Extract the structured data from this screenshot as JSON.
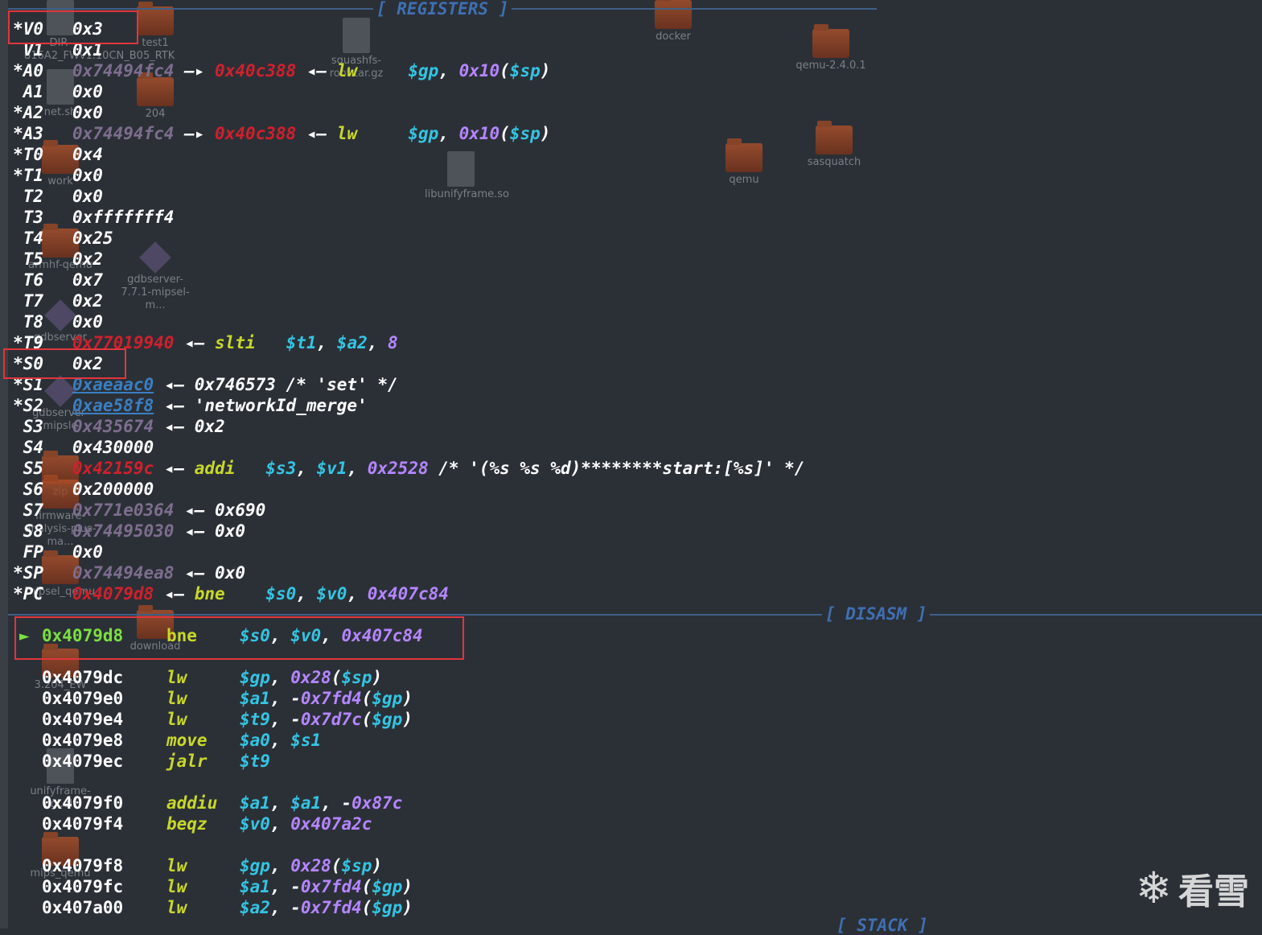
{
  "colors": {
    "background": "#2b3037",
    "header": "#3f6fb0",
    "pointer": "#d0202b",
    "data": "#7d6d8e",
    "mnemonic": "#c8d82a",
    "register": "#34c5e3",
    "immediate": "#b586ff",
    "highlight": "#e0363c"
  },
  "desktop": {
    "icons": [
      {
        "label": "DIR-816A2_FWv1.10CN_B05_RTK",
        "icon": "file-icon"
      },
      {
        "label": "test1",
        "icon": "folder-icon"
      },
      {
        "label": "squashfs-root.tar.gz",
        "icon": "archive-icon"
      },
      {
        "label": "docker",
        "icon": "folder-icon"
      },
      {
        "label": "qemu-2.4.0.1",
        "icon": "folder-icon"
      },
      {
        "label": "net.sh",
        "icon": "file-icon"
      },
      {
        "label": "204",
        "icon": "folder-icon"
      },
      {
        "label": "sasquatch",
        "icon": "folder-icon"
      },
      {
        "label": "qemu",
        "icon": "folder-icon"
      },
      {
        "label": "work",
        "icon": "folder-icon"
      },
      {
        "label": "libunifyframe.so",
        "icon": "file-icon"
      },
      {
        "label": "armhf-qemu",
        "icon": "folder-icon"
      },
      {
        "label": "gdbserver-7.7.1-mipsel-m...",
        "icon": "binary-icon"
      },
      {
        "label": "gdbserver",
        "icon": "binary-icon"
      },
      {
        "label": "gdbserver-mipsle",
        "icon": "binary-icon"
      },
      {
        "label": "zip",
        "icon": "folder-icon"
      },
      {
        "label": "firmware-analysis-plus-ma...",
        "icon": "folder-icon"
      },
      {
        "label": "mipsel_qemu",
        "icon": "folder-icon"
      },
      {
        "label": "download",
        "icon": "folder-icon"
      },
      {
        "label": "3.204_EW",
        "icon": "folder-icon"
      },
      {
        "label": "unifyframe-cgi.elf",
        "icon": "file-icon"
      },
      {
        "label": "mips_qemu",
        "icon": "folder-icon"
      }
    ]
  },
  "sections": {
    "registers": "[ REGISTERS ]",
    "disasm": "[ DISASM ]",
    "stack": "[ STACK ]"
  },
  "registers": [
    {
      "name": "*V0",
      "value": "0x3"
    },
    {
      "name": "V1",
      "value": "0x1"
    },
    {
      "name": "*A0",
      "addr": "0x74494fc4",
      "arrow": "—▸",
      "ptr": "0x40c388",
      "arrow2": "◂—",
      "mn": "lw",
      "ops": [
        [
          "$gp",
          "cyan"
        ],
        [
          ", ",
          "w"
        ],
        [
          "0x10",
          "purp"
        ],
        [
          "(",
          "w"
        ],
        [
          "$sp",
          "cyan"
        ],
        [
          ")",
          "w"
        ]
      ]
    },
    {
      "name": "A1",
      "value": "0x0"
    },
    {
      "name": "*A2",
      "value": "0x0"
    },
    {
      "name": "*A3",
      "addr": "0x74494fc4",
      "arrow": "—▸",
      "ptr": "0x40c388",
      "arrow2": "◂—",
      "mn": "lw",
      "ops": [
        [
          "$gp",
          "cyan"
        ],
        [
          ", ",
          "w"
        ],
        [
          "0x10",
          "purp"
        ],
        [
          "(",
          "w"
        ],
        [
          "$sp",
          "cyan"
        ],
        [
          ")",
          "w"
        ]
      ]
    },
    {
      "name": "*T0",
      "value": "0x4"
    },
    {
      "name": "*T1",
      "value": "0x0"
    },
    {
      "name": "T2",
      "value": "0x0"
    },
    {
      "name": "T3",
      "value": "0xfffffff4"
    },
    {
      "name": "T4",
      "value": "0x25"
    },
    {
      "name": "T5",
      "value": "0x2"
    },
    {
      "name": "T6",
      "value": "0x7"
    },
    {
      "name": "T7",
      "value": "0x2"
    },
    {
      "name": "T8",
      "value": "0x0"
    },
    {
      "name": "*T9",
      "red": "0x77019940",
      "arrow2": "◂—",
      "mn": "slti",
      "ops": [
        [
          "$t1",
          "cyan"
        ],
        [
          ", ",
          "w"
        ],
        [
          "$a2",
          "cyan"
        ],
        [
          ", ",
          "w"
        ],
        [
          "8",
          "purp"
        ]
      ]
    },
    {
      "name": "*S0",
      "value": "0x2"
    },
    {
      "name": "*S1",
      "link": "0xaeaac0",
      "arrow2": "◂—",
      "tail": "0x746573 /* 'set' */"
    },
    {
      "name": "*S2",
      "link": "0xae58f8",
      "arrow2": "◂—",
      "tail": "'networkId_merge'"
    },
    {
      "name": "S3",
      "dim": "0x435674",
      "arrow2": "◂—",
      "tail": "0x2"
    },
    {
      "name": "S4",
      "value": "0x430000"
    },
    {
      "name": "S5",
      "red": "0x42159c",
      "arrow2": "◂—",
      "mn": "addi",
      "ops": [
        [
          "$s3",
          "cyan"
        ],
        [
          ", ",
          "w"
        ],
        [
          "$v1",
          "cyan"
        ],
        [
          ", ",
          "w"
        ],
        [
          "0x2528",
          "purp"
        ],
        [
          " /* '(%s %s %d)********start:[%s]' */",
          "w"
        ]
      ]
    },
    {
      "name": "S6",
      "value": "0x200000"
    },
    {
      "name": "S7",
      "dim": "0x771e0364",
      "arrow2": "◂—",
      "tail": "0x690"
    },
    {
      "name": "S8",
      "dim": "0x74495030",
      "arrow2": "◂—",
      "tail": "0x0"
    },
    {
      "name": "FP",
      "value": "0x0"
    },
    {
      "name": "*SP",
      "dim": "0x74494ea8",
      "arrow2": "◂—",
      "tail": "0x0"
    },
    {
      "name": "*PC",
      "red": "0x4079d8",
      "arrow2": "◂—",
      "mn": "bne",
      "ops": [
        [
          "$s0",
          "cyan"
        ],
        [
          ", ",
          "w"
        ],
        [
          "$v0",
          "cyan"
        ],
        [
          ", ",
          "w"
        ],
        [
          "0x407c84",
          "purp"
        ]
      ]
    }
  ],
  "disasm": [
    {
      "arrow": "►",
      "addr": "0x4079d8",
      "mn": "bne",
      "ops": [
        [
          "$s0",
          "cyan"
        ],
        [
          ", ",
          "w"
        ],
        [
          "$v0",
          "cyan"
        ],
        [
          ", ",
          "w"
        ],
        [
          "0x407c84",
          "purp"
        ]
      ],
      "current": true
    },
    {
      "gap": true
    },
    {
      "addr": "0x4079dc",
      "mn": "lw",
      "ops": [
        [
          "$gp",
          "cyan"
        ],
        [
          ", ",
          "w"
        ],
        [
          "0x28",
          "purp"
        ],
        [
          "(",
          "w"
        ],
        [
          "$sp",
          "cyan"
        ],
        [
          ")",
          "w"
        ]
      ]
    },
    {
      "addr": "0x4079e0",
      "mn": "lw",
      "ops": [
        [
          "$a1",
          "cyan"
        ],
        [
          ", -",
          "w"
        ],
        [
          "0x7fd4",
          "purp"
        ],
        [
          "(",
          "w"
        ],
        [
          "$gp",
          "cyan"
        ],
        [
          ")",
          "w"
        ]
      ]
    },
    {
      "addr": "0x4079e4",
      "mn": "lw",
      "ops": [
        [
          "$t9",
          "cyan"
        ],
        [
          ", -",
          "w"
        ],
        [
          "0x7d7c",
          "purp"
        ],
        [
          "(",
          "w"
        ],
        [
          "$gp",
          "cyan"
        ],
        [
          ")",
          "w"
        ]
      ]
    },
    {
      "addr": "0x4079e8",
      "mn": "move",
      "ops": [
        [
          "$a0",
          "cyan"
        ],
        [
          ", ",
          "w"
        ],
        [
          "$s1",
          "cyan"
        ]
      ]
    },
    {
      "addr": "0x4079ec",
      "mn": "jalr",
      "ops": [
        [
          "$t9",
          "cyan"
        ]
      ]
    },
    {
      "gap": true
    },
    {
      "addr": "0x4079f0",
      "mn": "addiu",
      "ops": [
        [
          "$a1",
          "cyan"
        ],
        [
          ", ",
          "w"
        ],
        [
          "$a1",
          "cyan"
        ],
        [
          ", -",
          "w"
        ],
        [
          "0x87c",
          "purp"
        ]
      ]
    },
    {
      "addr": "0x4079f4",
      "mn": "beqz",
      "ops": [
        [
          "$v0",
          "cyan"
        ],
        [
          ", ",
          "w"
        ],
        [
          "0x407a2c",
          "purp"
        ]
      ]
    },
    {
      "gap": true
    },
    {
      "addr": "0x4079f8",
      "mn": "lw",
      "ops": [
        [
          "$gp",
          "cyan"
        ],
        [
          ", ",
          "w"
        ],
        [
          "0x28",
          "purp"
        ],
        [
          "(",
          "w"
        ],
        [
          "$sp",
          "cyan"
        ],
        [
          ")",
          "w"
        ]
      ]
    },
    {
      "addr": "0x4079fc",
      "mn": "lw",
      "ops": [
        [
          "$a1",
          "cyan"
        ],
        [
          ", -",
          "w"
        ],
        [
          "0x7fd4",
          "purp"
        ],
        [
          "(",
          "w"
        ],
        [
          "$gp",
          "cyan"
        ],
        [
          ")",
          "w"
        ]
      ]
    },
    {
      "addr": "0x407a00",
      "mn": "lw",
      "ops": [
        [
          "$a2",
          "cyan"
        ],
        [
          ", -",
          "w"
        ],
        [
          "0x7fd4",
          "purp"
        ],
        [
          "(",
          "w"
        ],
        [
          "$gp",
          "cyan"
        ],
        [
          ")",
          "w"
        ]
      ]
    }
  ],
  "watermark": {
    "text": "看雪",
    "icon": "snowflake-icon"
  }
}
